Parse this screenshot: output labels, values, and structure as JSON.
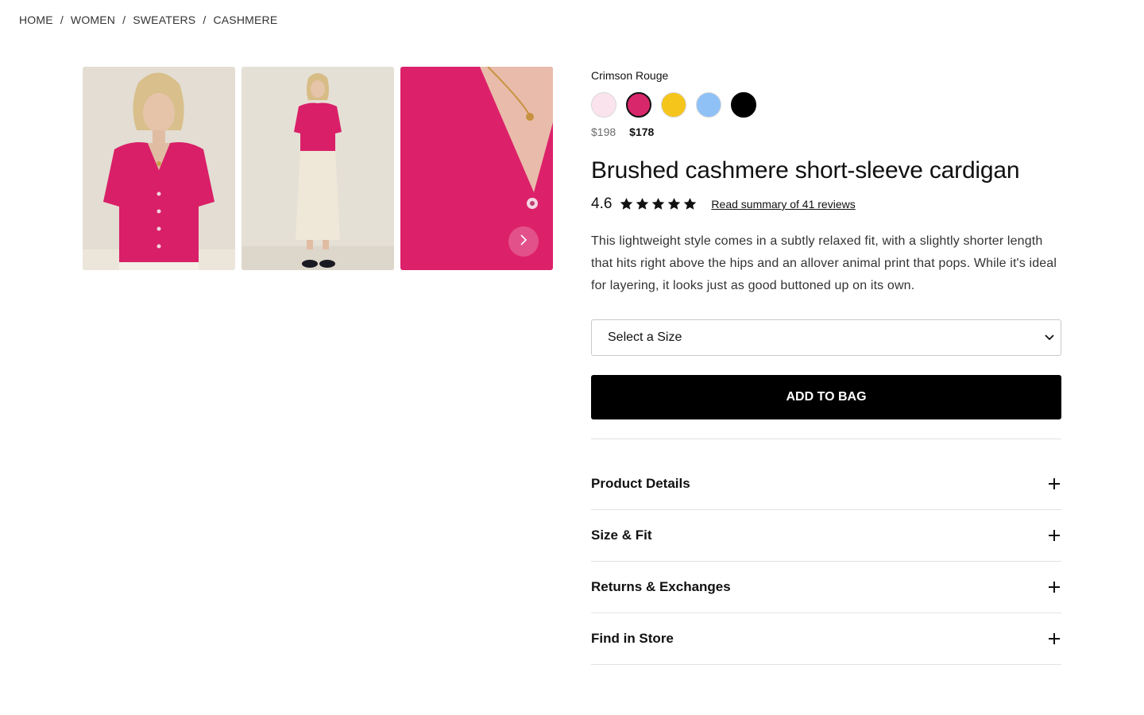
{
  "breadcrumb": {
    "items": [
      "HOME",
      "WOMEN",
      "SWEATERS",
      "CASHMERE"
    ],
    "separator": "/"
  },
  "gallery": {
    "images": [
      {
        "icon": "model-front-photo"
      },
      {
        "icon": "model-full-length-photo"
      },
      {
        "icon": "fabric-closeup-photo"
      }
    ],
    "next_icon": "chevron-right-icon"
  },
  "product": {
    "color_name": "Crimson Rouge",
    "swatches": [
      {
        "color": "#fbe3ee",
        "selected": false
      },
      {
        "color": "#d8276a",
        "selected": true
      },
      {
        "color": "#f6c51c",
        "selected": false
      },
      {
        "color": "#8fc1f7",
        "selected": false
      },
      {
        "color": "#000000",
        "selected": false
      }
    ],
    "price_original": "$198",
    "price_sale": "$178",
    "title": "Brushed cashmere short-sleeve cardigan",
    "rating": "4.6",
    "rating_stars": 5,
    "reviews_link": "Read summary of 41 reviews",
    "description": "This lightweight style comes in a subtly relaxed fit, with a slightly shorter length that hits right above the hips and an allover animal print that pops. While it's ideal for layering, it looks just as good buttoned up on its own.",
    "size_placeholder": "Select a Size",
    "add_to_bag": "ADD TO BAG"
  },
  "accordion": [
    {
      "label": "Product Details"
    },
    {
      "label": "Size & Fit"
    },
    {
      "label": "Returns & Exchanges"
    },
    {
      "label": "Find in Store"
    }
  ],
  "colors": {
    "sweater": "#d91f68",
    "button_bg": "#000000"
  }
}
